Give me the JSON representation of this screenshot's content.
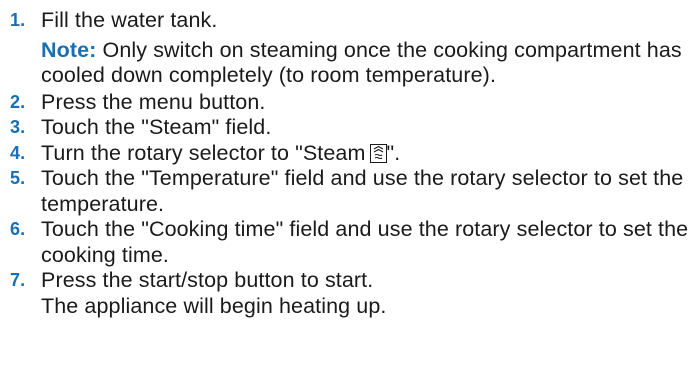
{
  "steps": [
    {
      "number": "1.",
      "text": "Fill the water tank.",
      "note_label": "Note:",
      "note_text": " Only switch on steaming once the cooking compartment has cooled down completely (to room temperature)."
    },
    {
      "number": "2.",
      "text": "Press the menu button."
    },
    {
      "number": "3.",
      "text": "Touch the \"Steam\" field."
    },
    {
      "number": "4.",
      "text_before": "Turn the rotary selector to \"Steam",
      "text_after": "\"."
    },
    {
      "number": "5.",
      "text": "Touch the \"Temperature\" field and use the rotary selector to set the temperature."
    },
    {
      "number": "6.",
      "text": "Touch the \"Cooking time\" field and use the rotary selector to set the cooking time."
    },
    {
      "number": "7.",
      "text": "Press the start/stop button to start.",
      "result": "The appliance will begin heating up."
    }
  ],
  "icons": {
    "steam_symbol": "steam-mode-icon"
  },
  "colors": {
    "step_number": "#1a6fb3",
    "note_label": "#1a6fb3",
    "body_text": "#1a1a1a"
  }
}
